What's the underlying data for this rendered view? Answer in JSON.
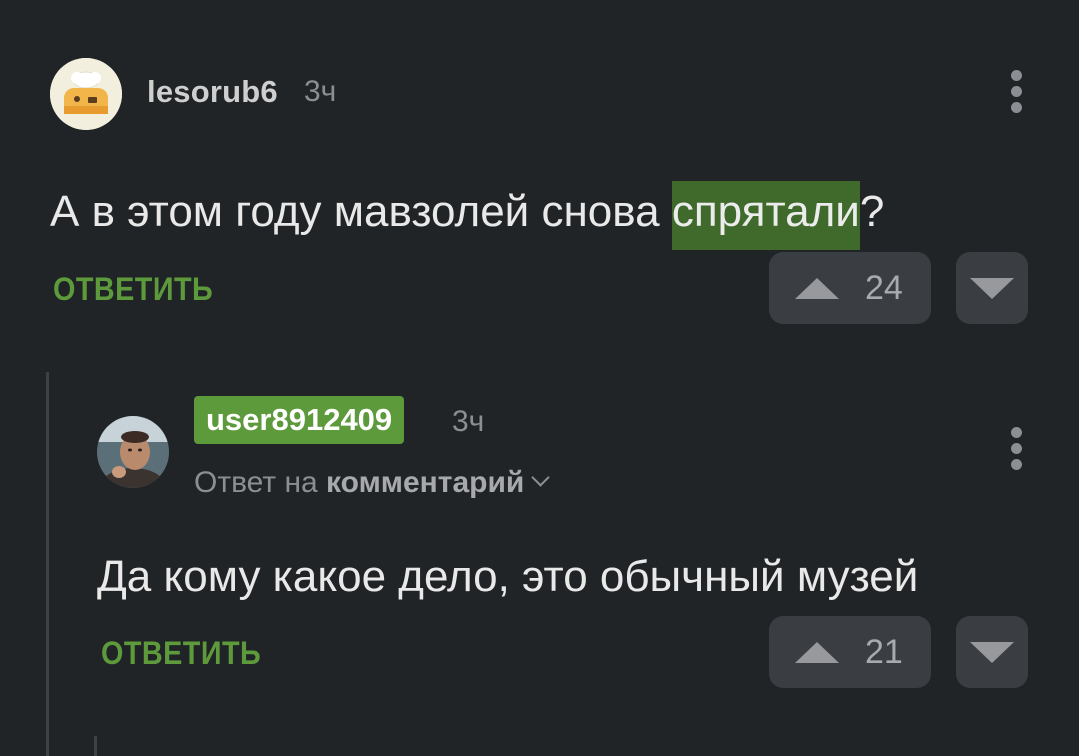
{
  "comments": [
    {
      "author": "lesorub6",
      "time": "3ч",
      "text_before": "А в этом году мавзолей снова ",
      "text_highlight": "спрятали",
      "text_after": "?",
      "reply_label": "ОТВЕТИТЬ",
      "rating": "24"
    },
    {
      "author": "user8912409",
      "time": "3ч",
      "reply_to_prefix": "Ответ на ",
      "reply_to_target": "комментарий",
      "text": "Да кому какое дело, это обычный музей",
      "reply_label": "ОТВЕТИТЬ",
      "rating": "21"
    }
  ],
  "icons": {
    "more": "more-vertical-icon",
    "upvote": "upvote-triangle-icon",
    "downvote": "downvote-triangle-icon",
    "expand": "chevron-down-icon"
  },
  "colors": {
    "background": "#212426",
    "accent_green": "#5d9a3c",
    "highlight": "#3f6a2b",
    "vote_button": "#3a3d41"
  }
}
